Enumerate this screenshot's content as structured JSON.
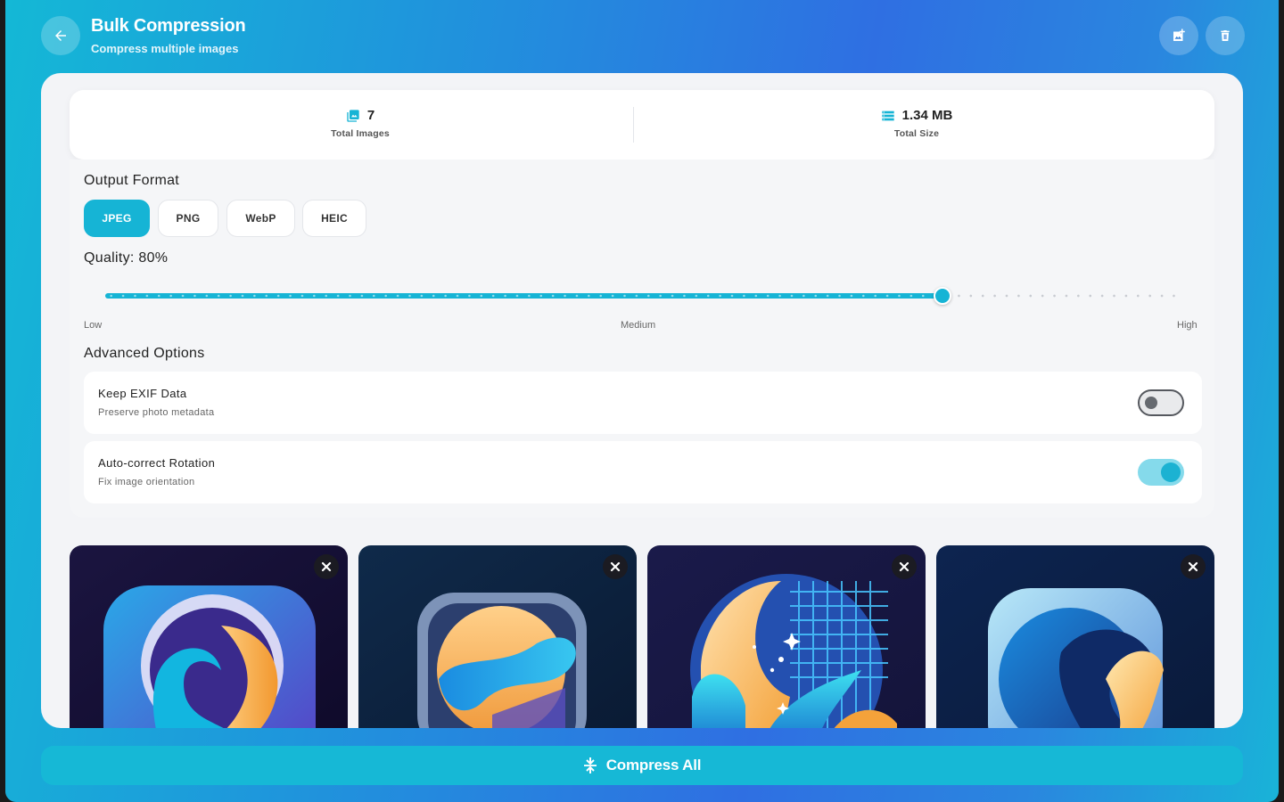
{
  "header": {
    "title": "Bulk Compression",
    "subtitle": "Compress multiple images",
    "back_icon": "arrow-left-icon",
    "add_icon": "add-photo-icon",
    "delete_icon": "trash-icon"
  },
  "stats": {
    "images": {
      "value": "7",
      "label": "Total Images",
      "icon": "photo-library-icon"
    },
    "size": {
      "value": "1.34 MB",
      "label": "Total Size",
      "icon": "storage-icon"
    }
  },
  "output_format": {
    "title": "Output Format",
    "options": [
      "JPEG",
      "PNG",
      "WebP",
      "HEIC"
    ],
    "selected": "JPEG"
  },
  "quality": {
    "label": "Quality: 80%",
    "value": 80,
    "low_label": "Low",
    "medium_label": "Medium",
    "high_label": "High"
  },
  "advanced": {
    "title": "Advanced Options",
    "options": [
      {
        "title": "Keep EXIF Data",
        "desc": "Preserve photo metadata",
        "enabled": false
      },
      {
        "title": "Auto-correct Rotation",
        "desc": "Fix image orientation",
        "enabled": true
      }
    ]
  },
  "images": [
    {
      "name": "image-thumbnail-1",
      "close_icon": "close-icon"
    },
    {
      "name": "image-thumbnail-2",
      "close_icon": "close-icon"
    },
    {
      "name": "image-thumbnail-3",
      "close_icon": "close-icon"
    },
    {
      "name": "image-thumbnail-4",
      "close_icon": "close-icon"
    }
  ],
  "footer": {
    "compress_label": "Compress All",
    "compress_icon": "compress-icon"
  },
  "colors": {
    "accent": "#16b4d5",
    "gradient_start": "#14b8d6",
    "gradient_mid": "#2f6fe2"
  }
}
